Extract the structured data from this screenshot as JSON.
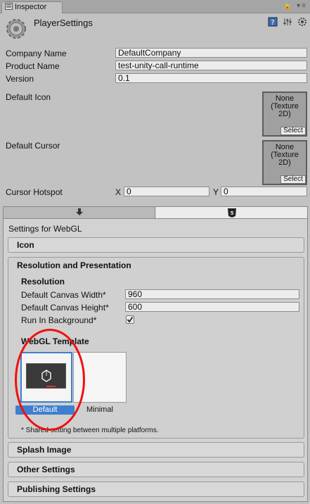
{
  "tab": {
    "label": "Inspector",
    "tools": "🔒 ▾≡"
  },
  "header": {
    "title": "PlayerSettings"
  },
  "fields": {
    "company_name": {
      "label": "Company Name",
      "value": "DefaultCompany"
    },
    "product_name": {
      "label": "Product Name",
      "value": "test-unity-call-runtime"
    },
    "version": {
      "label": "Version",
      "value": "0.1"
    },
    "default_icon": {
      "label": "Default Icon",
      "texture": "None\n(Texture\n2D)",
      "select": "Select"
    },
    "default_cursor": {
      "label": "Default Cursor",
      "texture": "None\n(Texture\n2D)",
      "select": "Select"
    },
    "cursor_hotspot": {
      "label": "Cursor Hotspot",
      "x_label": "X",
      "x_value": "0",
      "y_label": "Y",
      "y_value": "0"
    }
  },
  "platform": {
    "settings_for": "Settings for WebGL",
    "sections": {
      "icon": "Icon",
      "resolution_presentation": "Resolution and Presentation",
      "splash_image": "Splash Image",
      "other_settings": "Other Settings",
      "publishing_settings": "Publishing Settings"
    },
    "resolution": {
      "heading": "Resolution",
      "canvas_width_label": "Default Canvas Width*",
      "canvas_width_value": "960",
      "canvas_height_label": "Default Canvas Height*",
      "canvas_height_value": "600",
      "run_in_background_label": "Run In Background*",
      "run_in_background_checked": "true"
    },
    "webgl_template": {
      "heading": "WebGL Template",
      "options": [
        "Default",
        "Minimal"
      ],
      "selected": "Default"
    },
    "shared_note": "* Shared setting between multiple platforms."
  },
  "colors": {
    "selection_blue": "#3e7fd0",
    "annotation_red": "#e11"
  }
}
